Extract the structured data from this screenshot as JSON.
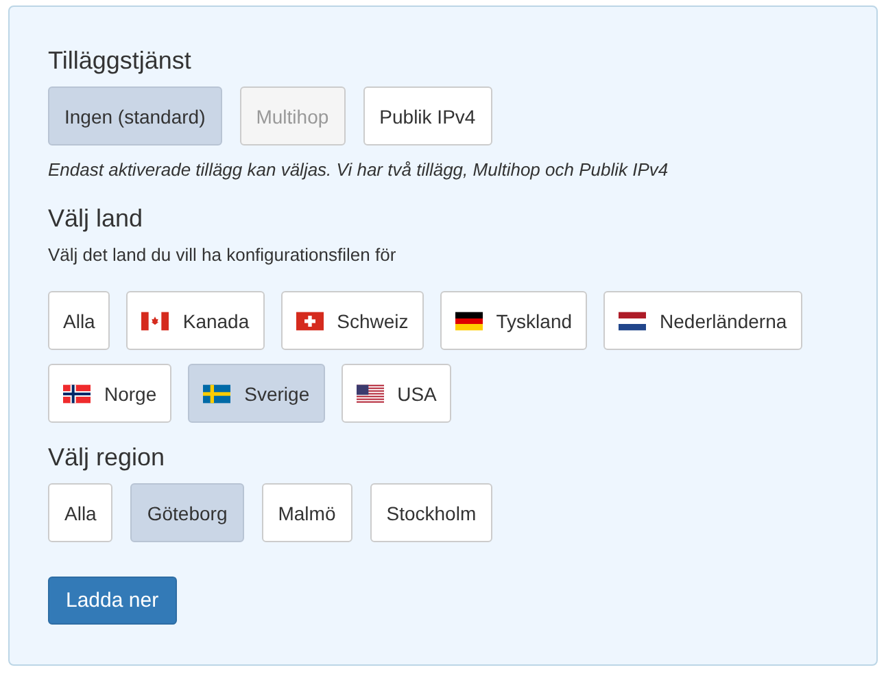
{
  "addon": {
    "heading": "Tilläggstjänst",
    "options": [
      {
        "label": "Ingen (standard)",
        "selected": true,
        "disabled": false
      },
      {
        "label": "Multihop",
        "selected": false,
        "disabled": true
      },
      {
        "label": "Publik IPv4",
        "selected": false,
        "disabled": false
      }
    ],
    "note": "Endast aktiverade tillägg kan väljas. Vi har två tillägg, Multihop och Publik IPv4"
  },
  "country": {
    "heading": "Välj land",
    "description": "Välj det land du vill ha konfigurationsfilen för",
    "options": [
      {
        "label": "Alla",
        "kind": "plain",
        "selected": false
      },
      {
        "label": "Kanada",
        "kind": "ca",
        "selected": false
      },
      {
        "label": "Schweiz",
        "kind": "ch",
        "selected": false
      },
      {
        "label": "Tyskland",
        "kind": "de",
        "selected": false
      },
      {
        "label": "Nederländerna",
        "kind": "nl",
        "selected": false
      },
      {
        "label": "Norge",
        "kind": "no",
        "selected": false
      },
      {
        "label": "Sverige",
        "kind": "se",
        "selected": true
      },
      {
        "label": "USA",
        "kind": "us",
        "selected": false
      }
    ]
  },
  "region": {
    "heading": "Välj region",
    "options": [
      {
        "label": "Alla",
        "selected": false
      },
      {
        "label": "Göteborg",
        "selected": true
      },
      {
        "label": "Malmö",
        "selected": false
      },
      {
        "label": "Stockholm",
        "selected": false
      }
    ]
  },
  "download_button": "Ladda ner"
}
